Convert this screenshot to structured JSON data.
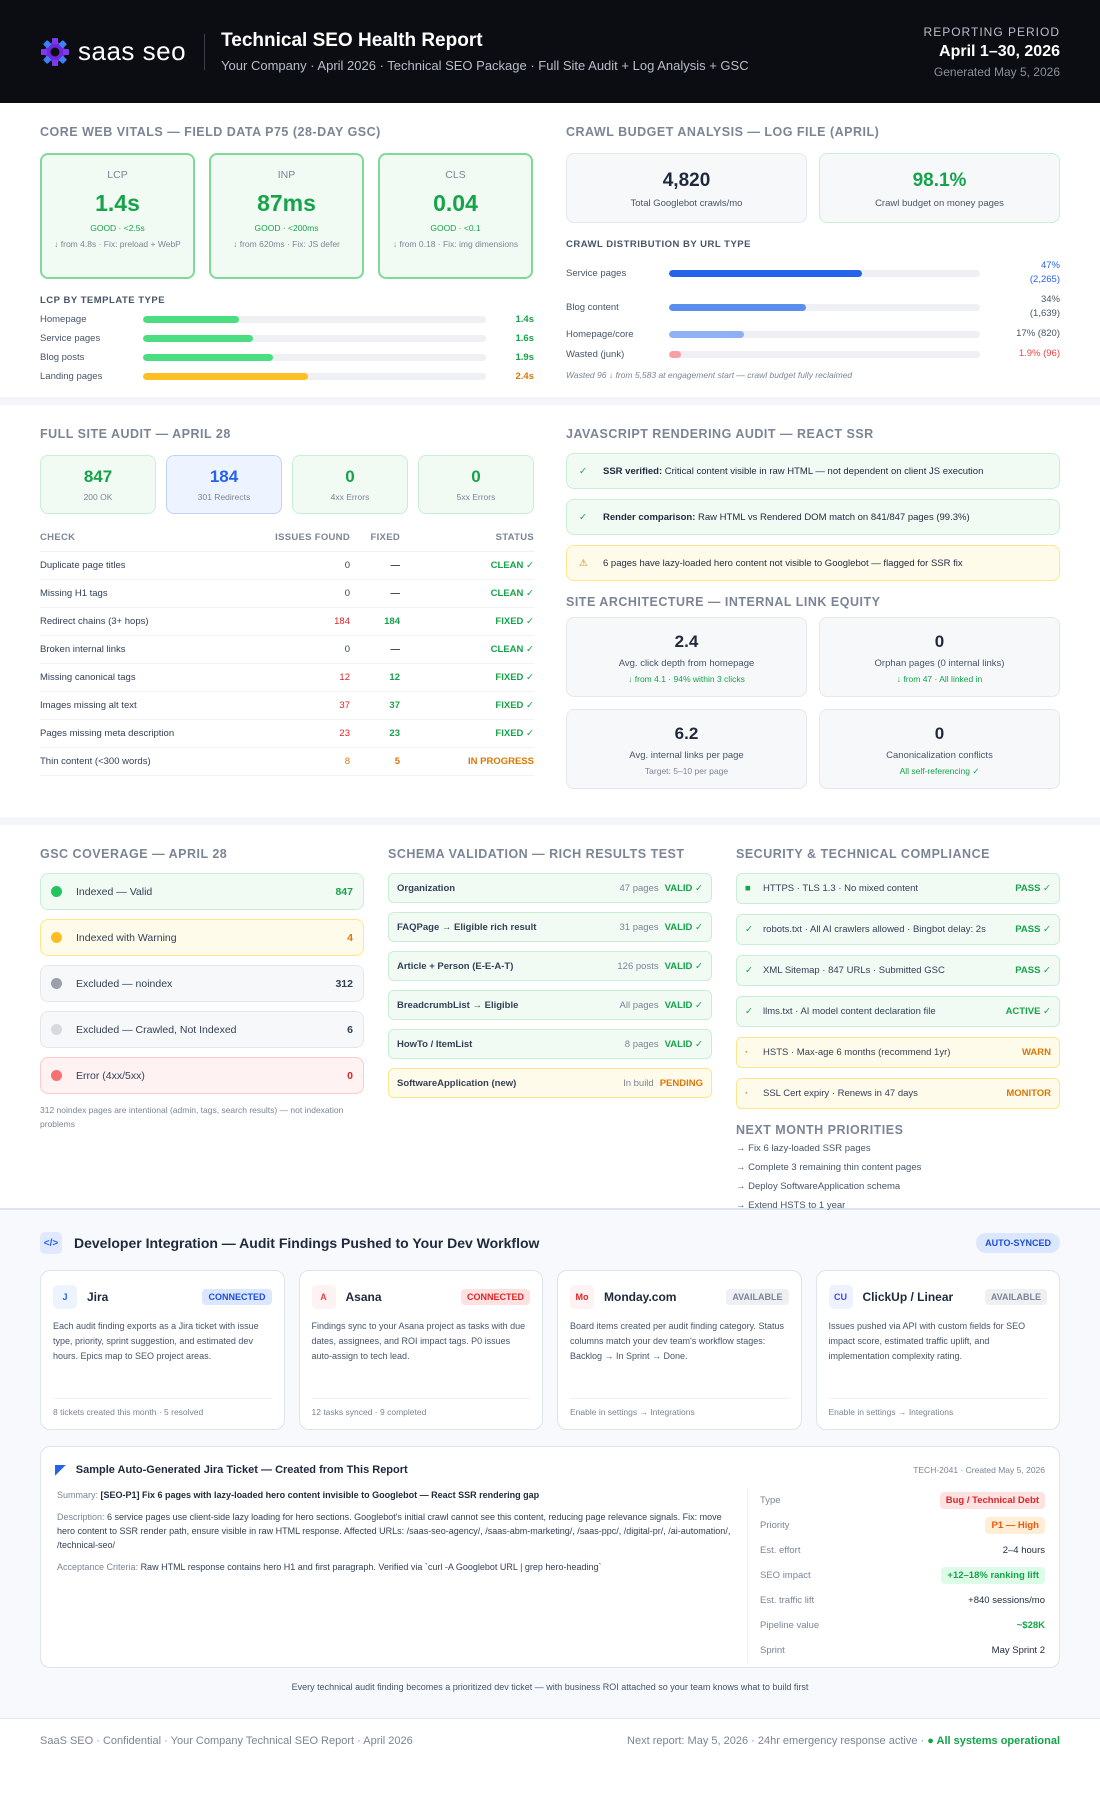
{
  "header": {
    "logo": "saas seo",
    "title": "Technical SEO Health Report",
    "subtitle": "Your Company · April 2026 · Technical SEO Package · Full Site Audit + Log Analysis + GSC",
    "period_label": "REPORTING PERIOD",
    "period": "April 1–30, 2026",
    "generated": "Generated May 5, 2026"
  },
  "cwv": {
    "title": "CORE WEB VITALS — FIELD DATA P75 (28-DAY GSC)",
    "vitals": [
      {
        "label": "LCP",
        "value": "1.4s",
        "status": "GOOD · <2.5s",
        "note": "↓ from 4.8s · Fix: preload + WebP"
      },
      {
        "label": "INP",
        "value": "87ms",
        "status": "GOOD · <200ms",
        "note": "↓ from 620ms · Fix: JS defer"
      },
      {
        "label": "CLS",
        "value": "0.04",
        "status": "GOOD · <0.1",
        "note": "↓ from 0.18 · Fix: img dimensions"
      }
    ],
    "lcp_title": "LCP BY TEMPLATE TYPE",
    "lcp_rows": [
      {
        "name": "Homepage",
        "value": "1.4s",
        "fill": 0.28,
        "color": "#4ade80"
      },
      {
        "name": "Service pages",
        "value": "1.6s",
        "fill": 0.32,
        "color": "#4ade80"
      },
      {
        "name": "Blog posts",
        "value": "1.9s",
        "fill": 0.38,
        "color": "#4ade80"
      },
      {
        "name": "Landing pages",
        "value": "2.4s",
        "fill": 0.48,
        "color": "#fbbf24"
      }
    ]
  },
  "crawl": {
    "title": "CRAWL BUDGET ANALYSIS — LOG FILE (APRIL)",
    "total": "4,820",
    "total_label": "Total Googlebot crawls/mo",
    "money": "98.1%",
    "money_label": "Crawl budget on money pages",
    "dist_title": "CRAWL DISTRIBUTION BY URL TYPE",
    "rows": [
      {
        "name": "Service pages",
        "pct": "47%",
        "count": "(2,265)",
        "fill": 0.62,
        "color": "#2563eb"
      },
      {
        "name": "Blog content",
        "pct": "34%",
        "count": "(1,639)",
        "fill": 0.44,
        "color": "#5b8def"
      },
      {
        "name": "Homepage/core",
        "pct": "17% (820)",
        "count": "",
        "fill": 0.24,
        "color": "#8fb0f5"
      },
      {
        "name": "Wasted (junk)",
        "pct": "1.9% (96)",
        "count": "",
        "fill": 0.04,
        "color": "#f7a1a6"
      }
    ],
    "note": "Wasted 96 ↓ from 5,583 at engagement start — crawl budget fully reclaimed"
  },
  "audit": {
    "title": "FULL SITE AUDIT — APRIL 28",
    "stats": [
      {
        "n": "847",
        "d": "200 OK"
      },
      {
        "n": "184",
        "d": "301 Redirects"
      },
      {
        "n": "0",
        "d": "4xx Errors"
      },
      {
        "n": "0",
        "d": "5xx Errors"
      }
    ],
    "cols": [
      "CHECK",
      "ISSUES FOUND",
      "FIXED",
      "STATUS"
    ],
    "rows": [
      {
        "check": "Duplicate page titles",
        "issues": "0",
        "fixed": "—",
        "status": "CLEAN ✓"
      },
      {
        "check": "Missing H1 tags",
        "issues": "0",
        "fixed": "—",
        "status": "CLEAN ✓"
      },
      {
        "check": "Redirect chains (3+ hops)",
        "issues": "184",
        "fixed": "184",
        "status": "FIXED ✓"
      },
      {
        "check": "Broken internal links",
        "issues": "0",
        "fixed": "—",
        "status": "CLEAN ✓"
      },
      {
        "check": "Missing canonical tags",
        "issues": "12",
        "fixed": "12",
        "status": "FIXED ✓"
      },
      {
        "check": "Images missing alt text",
        "issues": "37",
        "fixed": "37",
        "status": "FIXED ✓"
      },
      {
        "check": "Pages missing meta description",
        "issues": "23",
        "fixed": "23",
        "status": "FIXED ✓"
      },
      {
        "check": "Thin content (<300 words)",
        "issues": "8",
        "fixed": "5",
        "status": "IN PROGRESS"
      }
    ]
  },
  "js": {
    "title": "JAVASCRIPT RENDERING AUDIT — REACT SSR",
    "items": [
      {
        "bold": "SSR verified:",
        "text": " Critical content visible in raw HTML — not dependent on client JS execution"
      },
      {
        "bold": "Render comparison:",
        "text": " Raw HTML vs Rendered DOM match on 841/847 pages (99.3%)"
      },
      {
        "bold": "",
        "text": "6 pages have lazy-loaded hero content not visible to Googlebot — flagged for SSR fix"
      }
    ]
  },
  "arch": {
    "title": "SITE ARCHITECTURE — INTERNAL LINK EQUITY",
    "cards": [
      {
        "n": "2.4",
        "d": "Avg. click depth from homepage",
        "s": "↓ from 4.1 · 94% within 3 clicks"
      },
      {
        "n": "0",
        "d": "Orphan pages (0 internal links)",
        "s": "↓ from 47 · All linked in"
      },
      {
        "n": "6.2",
        "d": "Avg. internal links per page",
        "s": "Target: 5–10 per page"
      },
      {
        "n": "0",
        "d": "Canonicalization conflicts",
        "s": "All self-referencing ✓"
      }
    ]
  },
  "gsc": {
    "title": "GSC COVERAGE — APRIL 28",
    "items": [
      {
        "label": "Indexed — Valid",
        "value": "847"
      },
      {
        "label": "Indexed with Warning",
        "value": "4"
      },
      {
        "label": "Excluded — noindex",
        "value": "312"
      },
      {
        "label": "Excluded — Crawled, Not Indexed",
        "value": "6"
      },
      {
        "label": "Error (4xx/5xx)",
        "value": "0"
      }
    ],
    "note": "312 noindex pages are intentional (admin, tags, search results) — not indexation problems"
  },
  "schema": {
    "title": "SCHEMA VALIDATION — RICH RESULTS TEST",
    "items": [
      {
        "name": "Organization",
        "count": "47 pages",
        "status": "VALID ✓"
      },
      {
        "name": "FAQPage → Eligible rich result",
        "count": "31 pages",
        "status": "VALID ✓"
      },
      {
        "name": "Article + Person (E-E-A-T)",
        "count": "126 posts",
        "status": "VALID ✓"
      },
      {
        "name": "BreadcrumbList → Eligible",
        "count": "All pages",
        "status": "VALID ✓"
      },
      {
        "name": "HowTo / ItemList",
        "count": "8 pages",
        "status": "VALID ✓"
      },
      {
        "name": "SoftwareApplication (new)",
        "count": "In build",
        "status": "PENDING"
      }
    ]
  },
  "security": {
    "title": "SECURITY & TECHNICAL COMPLIANCE",
    "items": [
      {
        "text": "HTTPS · TLS 1.3 · No mixed content",
        "status": "PASS ✓"
      },
      {
        "text": "robots.txt · All AI crawlers allowed · Bingbot delay: 2s",
        "status": "PASS ✓"
      },
      {
        "text": "XML Sitemap · 847 URLs · Submitted GSC",
        "status": "PASS ✓"
      },
      {
        "text": "llms.txt · AI model content declaration file",
        "status": "ACTIVE ✓"
      },
      {
        "text": "HSTS · Max-age 6 months (recommend 1yr)",
        "status": "WARN"
      },
      {
        "text": "SSL Cert expiry · Renews in 47 days",
        "status": "MONITOR"
      }
    ],
    "next_title": "NEXT MONTH PRIORITIES",
    "next": [
      "→ Fix 6 lazy-loaded SSR pages",
      "→ Complete 3 remaining thin content pages",
      "→ Deploy SoftwareApplication schema",
      "→ Extend HSTS to 1 year"
    ]
  },
  "dev": {
    "title": "Developer Integration — Audit Findings Pushed to Your Dev Workflow",
    "badge": "AUTO-SYNCED",
    "cards": [
      {
        "icon": "J",
        "name": "Jira",
        "status": "CONNECTED",
        "desc": "Each audit finding exports as a Jira ticket with issue type, priority, sprint suggestion, and estimated dev hours. Epics map to SEO project areas.",
        "foot": "8 tickets created this month · 5 resolved"
      },
      {
        "icon": "A",
        "name": "Asana",
        "status": "CONNECTED",
        "desc": "Findings sync to your Asana project as tasks with due dates, assignees, and ROI impact tags. P0 issues auto-assign to tech lead.",
        "foot": "12 tasks synced · 9 completed"
      },
      {
        "icon": "Mo",
        "name": "Monday.com",
        "status": "AVAILABLE",
        "desc": "Board items created per audit finding category. Status columns match your dev team's workflow stages: Backlog → In Sprint → Done.",
        "foot": "Enable in settings → Integrations"
      },
      {
        "icon": "CU",
        "name": "ClickUp / Linear",
        "status": "AVAILABLE",
        "desc": "Issues pushed via API with custom fields for SEO impact score, estimated traffic uplift, and implementation complexity rating.",
        "foot": "Enable in settings → Integrations"
      }
    ],
    "ticket": {
      "title": "Sample Auto-Generated Jira Ticket — Created from This Report",
      "id": "TECH-2041 · Created May 5, 2026",
      "summary_label": "Summary:",
      "summary": "[SEO-P1] Fix 6 pages with lazy-loaded hero content invisible to Googlebot — React SSR rendering gap",
      "desc_label": "Description:",
      "desc": "6 service pages use client-side lazy loading for hero sections. Googlebot's initial crawl cannot see this content, reducing page relevance signals. Fix: move hero content to SSR render path, ensure visible in raw HTML response. Affected URLs: /saas-seo-agency/, /saas-abm-marketing/, /saas-ppc/, /digital-pr/, /ai-automation/, /technical-seo/",
      "acc_label": "Acceptance Criteria:",
      "acc": "Raw HTML response contains hero H1 and first paragraph. Verified via `curl -A Googlebot URL | grep hero-heading`",
      "fields": [
        {
          "k": "Type",
          "v": "Bug / Technical Debt"
        },
        {
          "k": "Priority",
          "v": "P1 — High"
        },
        {
          "k": "Est. effort",
          "v": "2–4 hours"
        },
        {
          "k": "SEO impact",
          "v": "+12–18% ranking lift"
        },
        {
          "k": "Est. traffic lift",
          "v": "+840 sessions/mo"
        },
        {
          "k": "Pipeline value",
          "v": "~$28K"
        },
        {
          "k": "Sprint",
          "v": "May Sprint 2"
        }
      ]
    },
    "footnote": "Every technical audit finding becomes a prioritized dev ticket — with business ROI attached so your team knows what to build first"
  },
  "footer": {
    "left": "SaaS SEO · Confidential · Your Company Technical SEO Report · April 2026",
    "right": "Next report: May 5, 2026 · 24hr emergency response active ·",
    "status": "● All systems operational"
  }
}
